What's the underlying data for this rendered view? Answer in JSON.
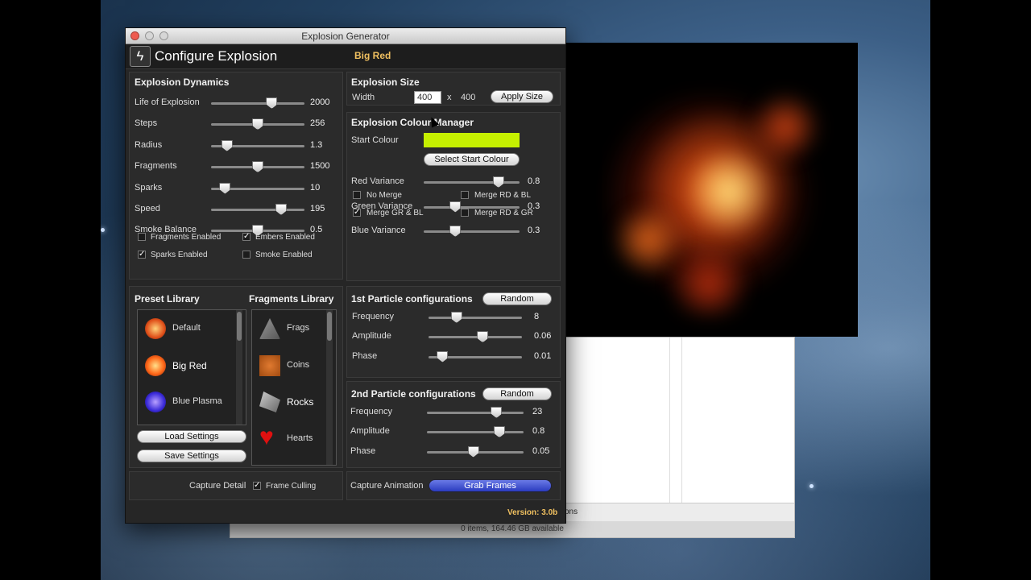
{
  "window": {
    "title": "Explosion Generator",
    "header_title": "Configure Explosion",
    "active_preset": "Big Red"
  },
  "dynamics": {
    "title": "Explosion Dynamics",
    "sliders": [
      {
        "label": "Life of Explosion",
        "value": "2000",
        "fraction": 0.65
      },
      {
        "label": "Steps",
        "value": "256",
        "fraction": 0.5
      },
      {
        "label": "Radius",
        "value": "1.3",
        "fraction": 0.17
      },
      {
        "label": "Fragments",
        "value": "1500",
        "fraction": 0.5
      },
      {
        "label": "Sparks",
        "value": "10",
        "fraction": 0.15
      },
      {
        "label": "Speed",
        "value": "195",
        "fraction": 0.75
      },
      {
        "label": "Smoke Balance",
        "value": "0.5",
        "fraction": 0.5
      }
    ],
    "checkboxes": [
      {
        "label": "Fragments Enabled",
        "checked": false
      },
      {
        "label": "Embers Enabled",
        "checked": true
      },
      {
        "label": "Sparks Enabled",
        "checked": true
      },
      {
        "label": "Smoke Enabled",
        "checked": false
      }
    ]
  },
  "size": {
    "title": "Explosion Size",
    "width_label": "Width",
    "width": "400",
    "times": "x",
    "height": "400",
    "apply_label": "Apply Size"
  },
  "colour": {
    "title": "Explosion Colour Manager",
    "start_label": "Start Colour",
    "start_colour": "#c6f000",
    "select_label": "Select Start Colour",
    "sliders": [
      {
        "label": "Red Variance",
        "value": "0.8",
        "fraction": 0.78
      },
      {
        "label": "Green Variance",
        "value": "0.3",
        "fraction": 0.33
      },
      {
        "label": "Blue Variance",
        "value": "0.3",
        "fraction": 0.33
      }
    ],
    "checkboxes": [
      {
        "label": "No Merge",
        "checked": false
      },
      {
        "label": "Merge RD & BL",
        "checked": false
      },
      {
        "label": "Merge GR & BL",
        "checked": true
      },
      {
        "label": "Merge RD & GR",
        "checked": false
      }
    ]
  },
  "library": {
    "preset_title": "Preset Library",
    "fragments_title": "Fragments Library",
    "presets": [
      {
        "label": "Default",
        "icon": "default-explosion-icon"
      },
      {
        "label": "Big Red",
        "icon": "big-red-explosion-icon"
      },
      {
        "label": "Blue Plasma",
        "icon": "blue-plasma-icon"
      }
    ],
    "fragments": [
      {
        "label": "Frags",
        "icon": "frags-icon"
      },
      {
        "label": "Coins",
        "icon": "coin-icon"
      },
      {
        "label": "Rocks",
        "icon": "rock-icon"
      },
      {
        "label": "Hearts",
        "icon": "heart-icon"
      }
    ],
    "load_label": "Load Settings",
    "save_label": "Save Settings"
  },
  "particles1": {
    "title": "1st Particle configurations",
    "random_label": "Random",
    "sliders": [
      {
        "label": "Frequency",
        "value": "8",
        "fraction": 0.3
      },
      {
        "label": "Amplitude",
        "value": "0.06",
        "fraction": 0.58
      },
      {
        "label": "Phase",
        "value": "0.01",
        "fraction": 0.15
      }
    ]
  },
  "particles2": {
    "title": "2nd Particle configurations",
    "random_label": "Random",
    "sliders": [
      {
        "label": "Frequency",
        "value": "23",
        "fraction": 0.72
      },
      {
        "label": "Amplitude",
        "value": "0.8",
        "fraction": 0.75
      },
      {
        "label": "Phase",
        "value": "0.05",
        "fraction": 0.48
      }
    ]
  },
  "capture": {
    "detail_label": "Capture Detail",
    "culling_label": "Frame Culling",
    "culling_checked": true,
    "animation_label": "Capture Animation",
    "grab_label": "Grab Frames"
  },
  "version": "Version: 3.0b",
  "finder": {
    "path_fragment": "ons",
    "status": "0 items, 164.46 GB available"
  }
}
